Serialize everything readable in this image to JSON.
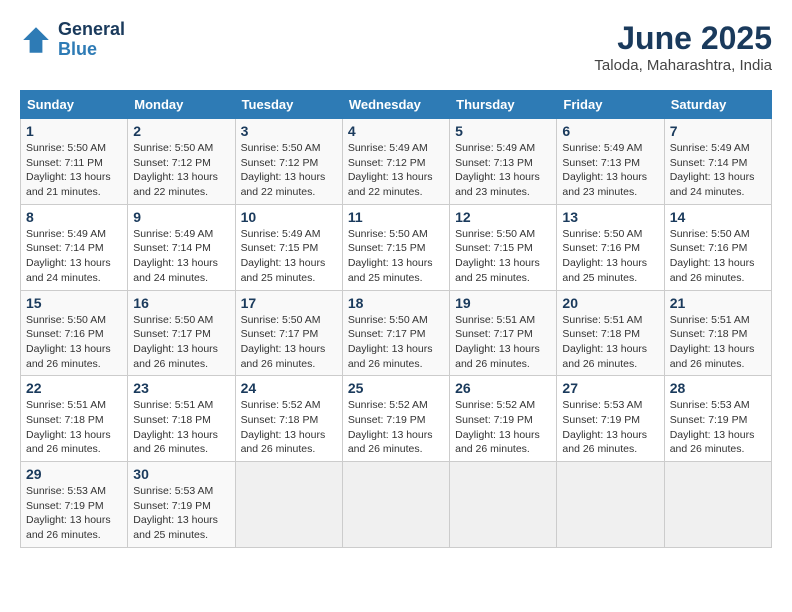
{
  "header": {
    "logo_line1": "General",
    "logo_line2": "Blue",
    "month_year": "June 2025",
    "location": "Taloda, Maharashtra, India"
  },
  "weekdays": [
    "Sunday",
    "Monday",
    "Tuesday",
    "Wednesday",
    "Thursday",
    "Friday",
    "Saturday"
  ],
  "weeks": [
    [
      {
        "day": "1",
        "info": "Sunrise: 5:50 AM\nSunset: 7:11 PM\nDaylight: 13 hours\nand 21 minutes."
      },
      {
        "day": "2",
        "info": "Sunrise: 5:50 AM\nSunset: 7:12 PM\nDaylight: 13 hours\nand 22 minutes."
      },
      {
        "day": "3",
        "info": "Sunrise: 5:50 AM\nSunset: 7:12 PM\nDaylight: 13 hours\nand 22 minutes."
      },
      {
        "day": "4",
        "info": "Sunrise: 5:49 AM\nSunset: 7:12 PM\nDaylight: 13 hours\nand 22 minutes."
      },
      {
        "day": "5",
        "info": "Sunrise: 5:49 AM\nSunset: 7:13 PM\nDaylight: 13 hours\nand 23 minutes."
      },
      {
        "day": "6",
        "info": "Sunrise: 5:49 AM\nSunset: 7:13 PM\nDaylight: 13 hours\nand 23 minutes."
      },
      {
        "day": "7",
        "info": "Sunrise: 5:49 AM\nSunset: 7:14 PM\nDaylight: 13 hours\nand 24 minutes."
      }
    ],
    [
      {
        "day": "8",
        "info": "Sunrise: 5:49 AM\nSunset: 7:14 PM\nDaylight: 13 hours\nand 24 minutes."
      },
      {
        "day": "9",
        "info": "Sunrise: 5:49 AM\nSunset: 7:14 PM\nDaylight: 13 hours\nand 24 minutes."
      },
      {
        "day": "10",
        "info": "Sunrise: 5:49 AM\nSunset: 7:15 PM\nDaylight: 13 hours\nand 25 minutes."
      },
      {
        "day": "11",
        "info": "Sunrise: 5:50 AM\nSunset: 7:15 PM\nDaylight: 13 hours\nand 25 minutes."
      },
      {
        "day": "12",
        "info": "Sunrise: 5:50 AM\nSunset: 7:15 PM\nDaylight: 13 hours\nand 25 minutes."
      },
      {
        "day": "13",
        "info": "Sunrise: 5:50 AM\nSunset: 7:16 PM\nDaylight: 13 hours\nand 25 minutes."
      },
      {
        "day": "14",
        "info": "Sunrise: 5:50 AM\nSunset: 7:16 PM\nDaylight: 13 hours\nand 26 minutes."
      }
    ],
    [
      {
        "day": "15",
        "info": "Sunrise: 5:50 AM\nSunset: 7:16 PM\nDaylight: 13 hours\nand 26 minutes."
      },
      {
        "day": "16",
        "info": "Sunrise: 5:50 AM\nSunset: 7:17 PM\nDaylight: 13 hours\nand 26 minutes."
      },
      {
        "day": "17",
        "info": "Sunrise: 5:50 AM\nSunset: 7:17 PM\nDaylight: 13 hours\nand 26 minutes."
      },
      {
        "day": "18",
        "info": "Sunrise: 5:50 AM\nSunset: 7:17 PM\nDaylight: 13 hours\nand 26 minutes."
      },
      {
        "day": "19",
        "info": "Sunrise: 5:51 AM\nSunset: 7:17 PM\nDaylight: 13 hours\nand 26 minutes."
      },
      {
        "day": "20",
        "info": "Sunrise: 5:51 AM\nSunset: 7:18 PM\nDaylight: 13 hours\nand 26 minutes."
      },
      {
        "day": "21",
        "info": "Sunrise: 5:51 AM\nSunset: 7:18 PM\nDaylight: 13 hours\nand 26 minutes."
      }
    ],
    [
      {
        "day": "22",
        "info": "Sunrise: 5:51 AM\nSunset: 7:18 PM\nDaylight: 13 hours\nand 26 minutes."
      },
      {
        "day": "23",
        "info": "Sunrise: 5:51 AM\nSunset: 7:18 PM\nDaylight: 13 hours\nand 26 minutes."
      },
      {
        "day": "24",
        "info": "Sunrise: 5:52 AM\nSunset: 7:18 PM\nDaylight: 13 hours\nand 26 minutes."
      },
      {
        "day": "25",
        "info": "Sunrise: 5:52 AM\nSunset: 7:19 PM\nDaylight: 13 hours\nand 26 minutes."
      },
      {
        "day": "26",
        "info": "Sunrise: 5:52 AM\nSunset: 7:19 PM\nDaylight: 13 hours\nand 26 minutes."
      },
      {
        "day": "27",
        "info": "Sunrise: 5:53 AM\nSunset: 7:19 PM\nDaylight: 13 hours\nand 26 minutes."
      },
      {
        "day": "28",
        "info": "Sunrise: 5:53 AM\nSunset: 7:19 PM\nDaylight: 13 hours\nand 26 minutes."
      }
    ],
    [
      {
        "day": "29",
        "info": "Sunrise: 5:53 AM\nSunset: 7:19 PM\nDaylight: 13 hours\nand 26 minutes."
      },
      {
        "day": "30",
        "info": "Sunrise: 5:53 AM\nSunset: 7:19 PM\nDaylight: 13 hours\nand 25 minutes."
      },
      {
        "day": "",
        "info": ""
      },
      {
        "day": "",
        "info": ""
      },
      {
        "day": "",
        "info": ""
      },
      {
        "day": "",
        "info": ""
      },
      {
        "day": "",
        "info": ""
      }
    ]
  ]
}
